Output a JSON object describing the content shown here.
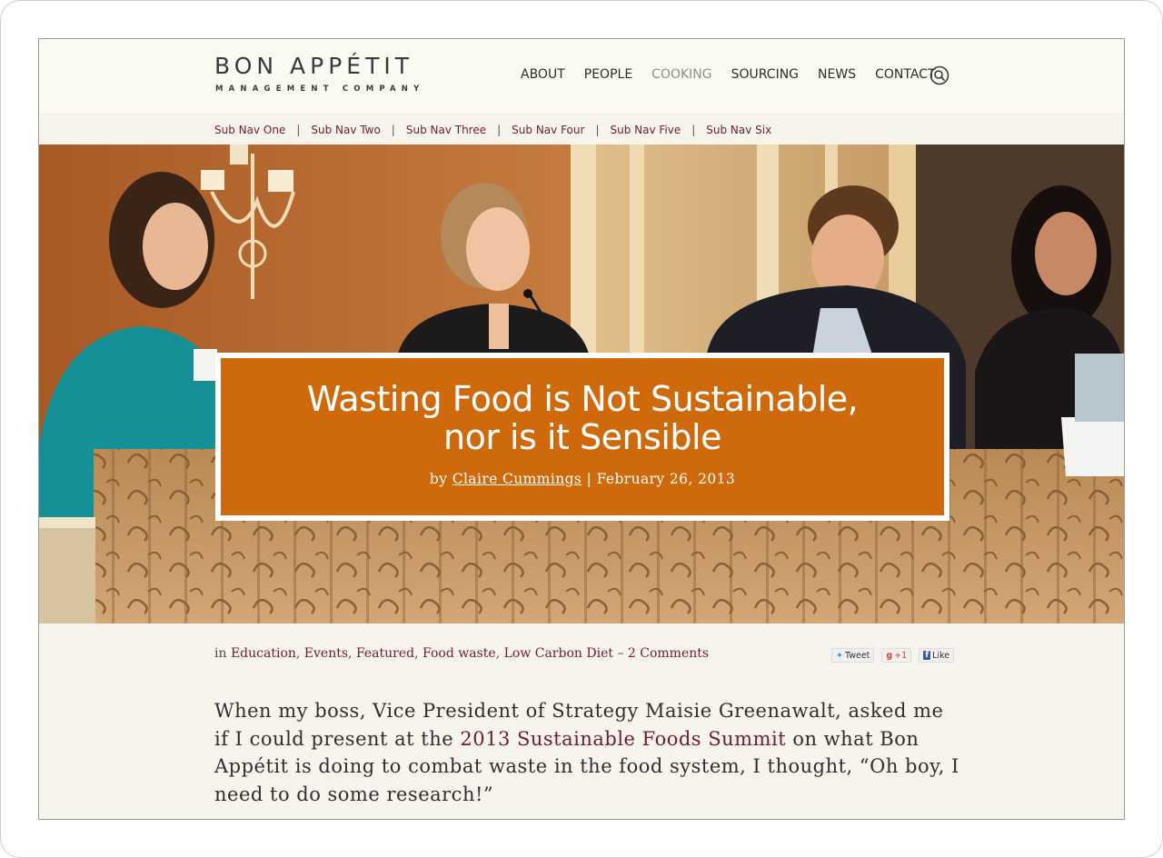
{
  "brand": {
    "name": "BON APPÉTIT",
    "tagline": "MANAGEMENT COMPANY"
  },
  "nav": {
    "items": [
      {
        "label": "ABOUT"
      },
      {
        "label": "PEOPLE"
      },
      {
        "label": "COOKING",
        "active": true
      },
      {
        "label": "SOURCING"
      },
      {
        "label": "NEWS"
      },
      {
        "label": "CONTACT"
      }
    ],
    "search_icon": "search-icon"
  },
  "subnav": {
    "items": [
      "Sub Nav One",
      "Sub Nav Two",
      "Sub Nav Three",
      "Sub Nav Four",
      "Sub Nav Five",
      "Sub Nav Six"
    ],
    "separator": "|"
  },
  "hero": {
    "title": "Wasting Food is Not Sustainable,\nnor is it Sensible",
    "by": "by",
    "author": "Claire Cummings",
    "separator": "|",
    "date": "February 26, 2013"
  },
  "meta": {
    "prefix": "in",
    "categories": [
      "Education",
      "Events",
      "Featured",
      "Food waste",
      "Low Carbon Diet"
    ],
    "comments": "2 Comments"
  },
  "share": {
    "tweet": "Tweet",
    "gplus": "+1",
    "like": "Like"
  },
  "body": {
    "part1": "When my boss, Vice President of Strategy Maisie Greenawalt, asked me if I could present at the ",
    "link": "2013 Sustainable Foods Summit",
    "part2": " on what Bon Appétit is doing to combat waste in the food system, I thought, “Oh boy, I need to do some research!”"
  },
  "colors": {
    "accent": "#6e1e29",
    "title_card": "#cf6a0c",
    "page_bg": "#f6f4ec"
  }
}
